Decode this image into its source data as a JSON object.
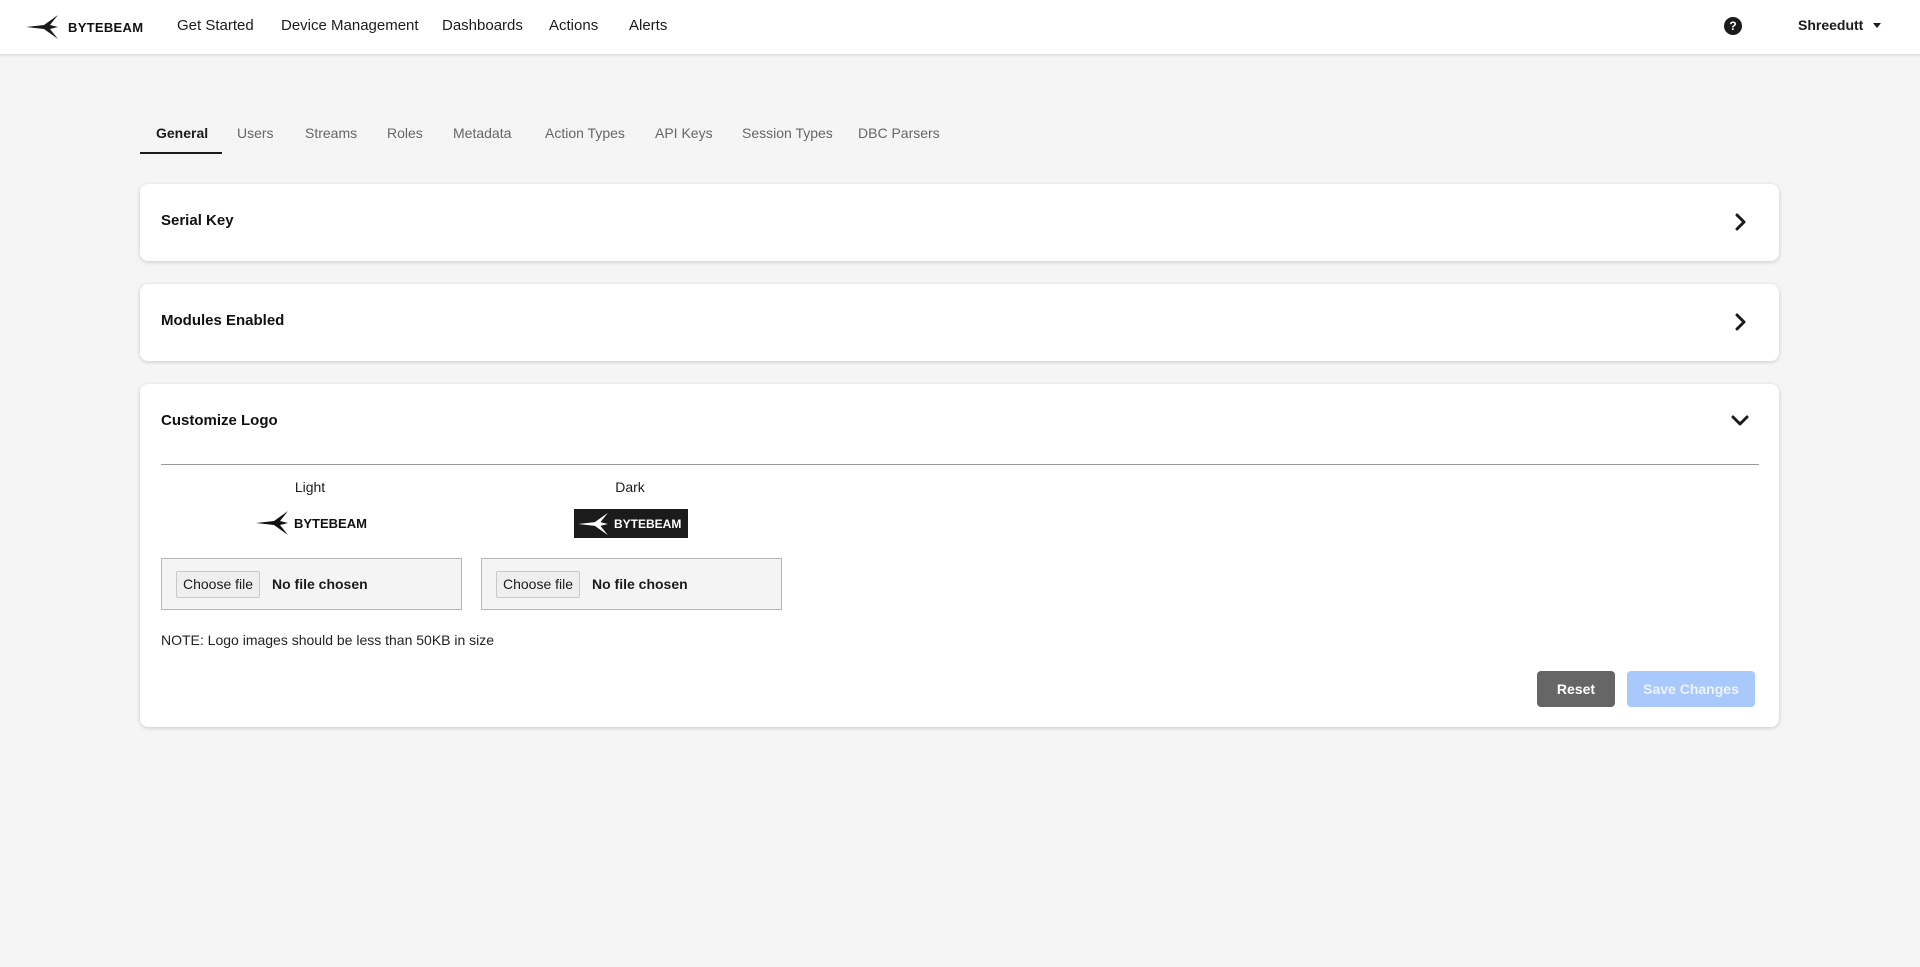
{
  "brand": {
    "name": "BYTEBEAM",
    "icon": "bytebeam-bird-logo"
  },
  "nav": {
    "items": [
      "Get Started",
      "Device Management",
      "Dashboards",
      "Actions",
      "Alerts"
    ],
    "help_icon": "question-circle-icon",
    "user": "Shreedutt"
  },
  "tabs": [
    "General",
    "Users",
    "Streams",
    "Roles",
    "Metadata",
    "Action Types",
    "API Keys",
    "Session Types",
    "DBC Parsers"
  ],
  "active_tab": "General",
  "sections": {
    "serial_key": {
      "title": "Serial Key",
      "icon": "chevron-right-icon"
    },
    "modules": {
      "title": "Modules Enabled",
      "icon": "chevron-right-icon"
    },
    "customize_logo": {
      "title": "Customize Logo",
      "icon": "chevron-down-icon",
      "light": {
        "label": "Light",
        "logo_text": "BYTEBEAM",
        "button": "Choose file",
        "status": "No file chosen"
      },
      "dark": {
        "label": "Dark",
        "logo_text": "BYTEBEAM",
        "button": "Choose file",
        "status": "No file chosen"
      },
      "note": "NOTE: Logo images should be less than 50KB in size",
      "reset_label": "Reset",
      "save_label": "Save Changes"
    }
  },
  "colors": {
    "save_disabled": "#a9c8fb",
    "reset": "#666666",
    "background": "#f5f5f5"
  }
}
